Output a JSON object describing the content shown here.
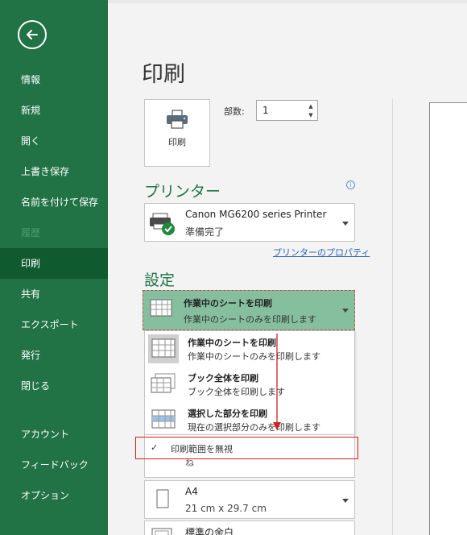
{
  "sidebar": {
    "back_label": "戻る",
    "items": [
      {
        "label": "情報"
      },
      {
        "label": "新規"
      },
      {
        "label": "開く"
      },
      {
        "label": "上書き保存"
      },
      {
        "label": "名前を付けて保存"
      },
      {
        "label": "履歴"
      },
      {
        "label": "印刷"
      },
      {
        "label": "共有"
      },
      {
        "label": "エクスポート"
      },
      {
        "label": "発行"
      },
      {
        "label": "閉じる"
      },
      {
        "label": "アカウント"
      },
      {
        "label": "フィードバック"
      },
      {
        "label": "オプション"
      }
    ],
    "active": "印刷",
    "disabled": "履歴"
  },
  "main": {
    "title": "印刷",
    "print_button_label": "印刷",
    "copies_label": "部数:",
    "copies_value": "1"
  },
  "printer": {
    "heading": "プリンター",
    "name": "Canon MG6200 series Printer",
    "status": "準備完了",
    "properties_link": "プリンターのプロパティ"
  },
  "settings": {
    "heading": "設定",
    "selected": {
      "title": "作業中のシートを印刷",
      "subtitle": "作業中のシートのみを印刷します"
    },
    "options": [
      {
        "title": "作業中のシートを印刷",
        "subtitle": "作業中のシートのみを印刷します"
      },
      {
        "title": "ブック全体を印刷",
        "subtitle": "ブック全体を印刷します"
      },
      {
        "title": "選択した部分を印刷",
        "subtitle": "現在の選択部分のみを印刷します"
      }
    ],
    "ignore_print_area": {
      "label": "印刷範囲を無視",
      "checked": true,
      "peek_text": "ね"
    }
  },
  "paper": {
    "name": "A4",
    "dimensions": "21 cm x 29.7 cm"
  },
  "margins": {
    "name": "標準の余白"
  },
  "colors": {
    "sidebar": "#217346",
    "sidebar_active": "#0f5a2f",
    "accent": "#217346",
    "highlight": "#86bf9d",
    "annotation_red": "#d02020"
  }
}
